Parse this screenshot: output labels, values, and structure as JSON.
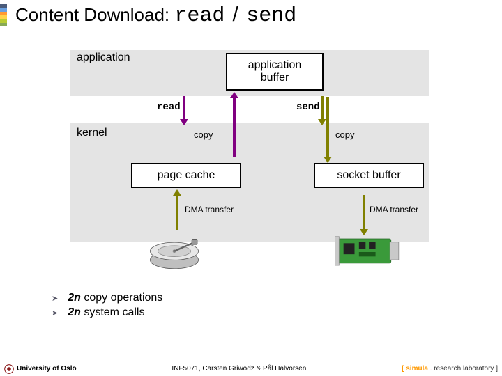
{
  "title": {
    "prefix": "Content Download:",
    "code1": "read",
    "sep": "/",
    "code2": "send"
  },
  "layers": {
    "application": "application",
    "kernel": "kernel",
    "app_buffer": "application\nbuffer",
    "page_cache": "page cache",
    "socket_buffer": "socket buffer"
  },
  "labels": {
    "read": "read",
    "send": "send",
    "copy": "copy",
    "dma": "DMA transfer"
  },
  "colors": {
    "layer_bg": "#e4e4e4",
    "arrow_read_copy": "#800080",
    "arrow_dma_send": "#808000"
  },
  "bullets": [
    {
      "prefix": "2n",
      "rest": " copy operations"
    },
    {
      "prefix": "2n",
      "rest": " system calls"
    }
  ],
  "footer": {
    "left": "University of Oslo",
    "center": "INF5071, Carsten Griwodz & Pål Halvorsen",
    "right_pre": "[ ",
    "right_brand": "simula",
    "right_dot": " . ",
    "right_rest": "research laboratory ]"
  },
  "rainbow": [
    "#4a5a7a",
    "#6aa0e0",
    "#ff9933",
    "#ffd24a",
    "#b9cc33",
    "#88aa55"
  ]
}
